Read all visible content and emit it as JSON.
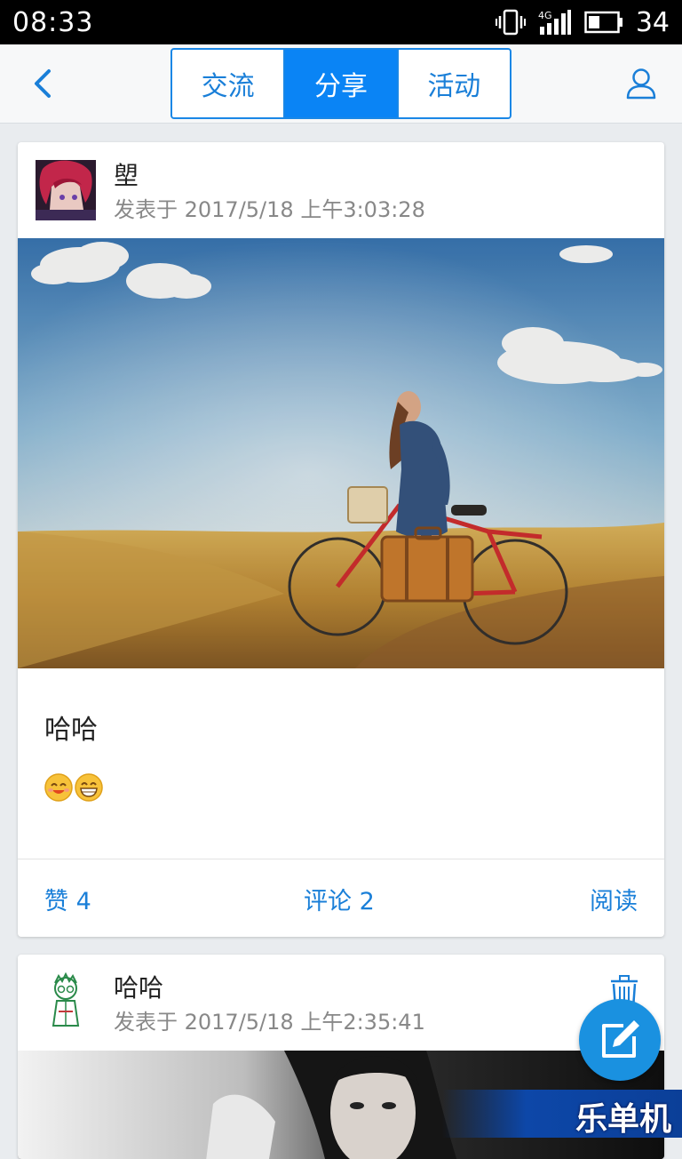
{
  "status_bar": {
    "time": "08:33",
    "network": "4G",
    "battery": "34"
  },
  "header": {
    "back_icon": "chevron-left-icon",
    "tabs": [
      {
        "label": "交流",
        "active": false
      },
      {
        "label": "分享",
        "active": true
      },
      {
        "label": "活动",
        "active": false
      }
    ],
    "profile_icon": "user-icon"
  },
  "posts": [
    {
      "author": "塱",
      "posted": "发表于 2017/5/18 上午3:03:28",
      "text": "哈哈",
      "emojis": [
        "smiling-face-emoji",
        "grinning-face-emoji"
      ],
      "actions": {
        "like": "赞 4",
        "comment": "评论 2",
        "read": "阅读"
      }
    },
    {
      "author": "哈哈",
      "posted": "发表于 2017/5/18 上午2:35:41",
      "delete_icon": "trash-icon"
    }
  ],
  "fab_icon": "edit-icon",
  "watermark": "乐单机",
  "colors": {
    "accent": "#0a84f5",
    "link": "#1a7fd8",
    "fab": "#1a91e0"
  }
}
